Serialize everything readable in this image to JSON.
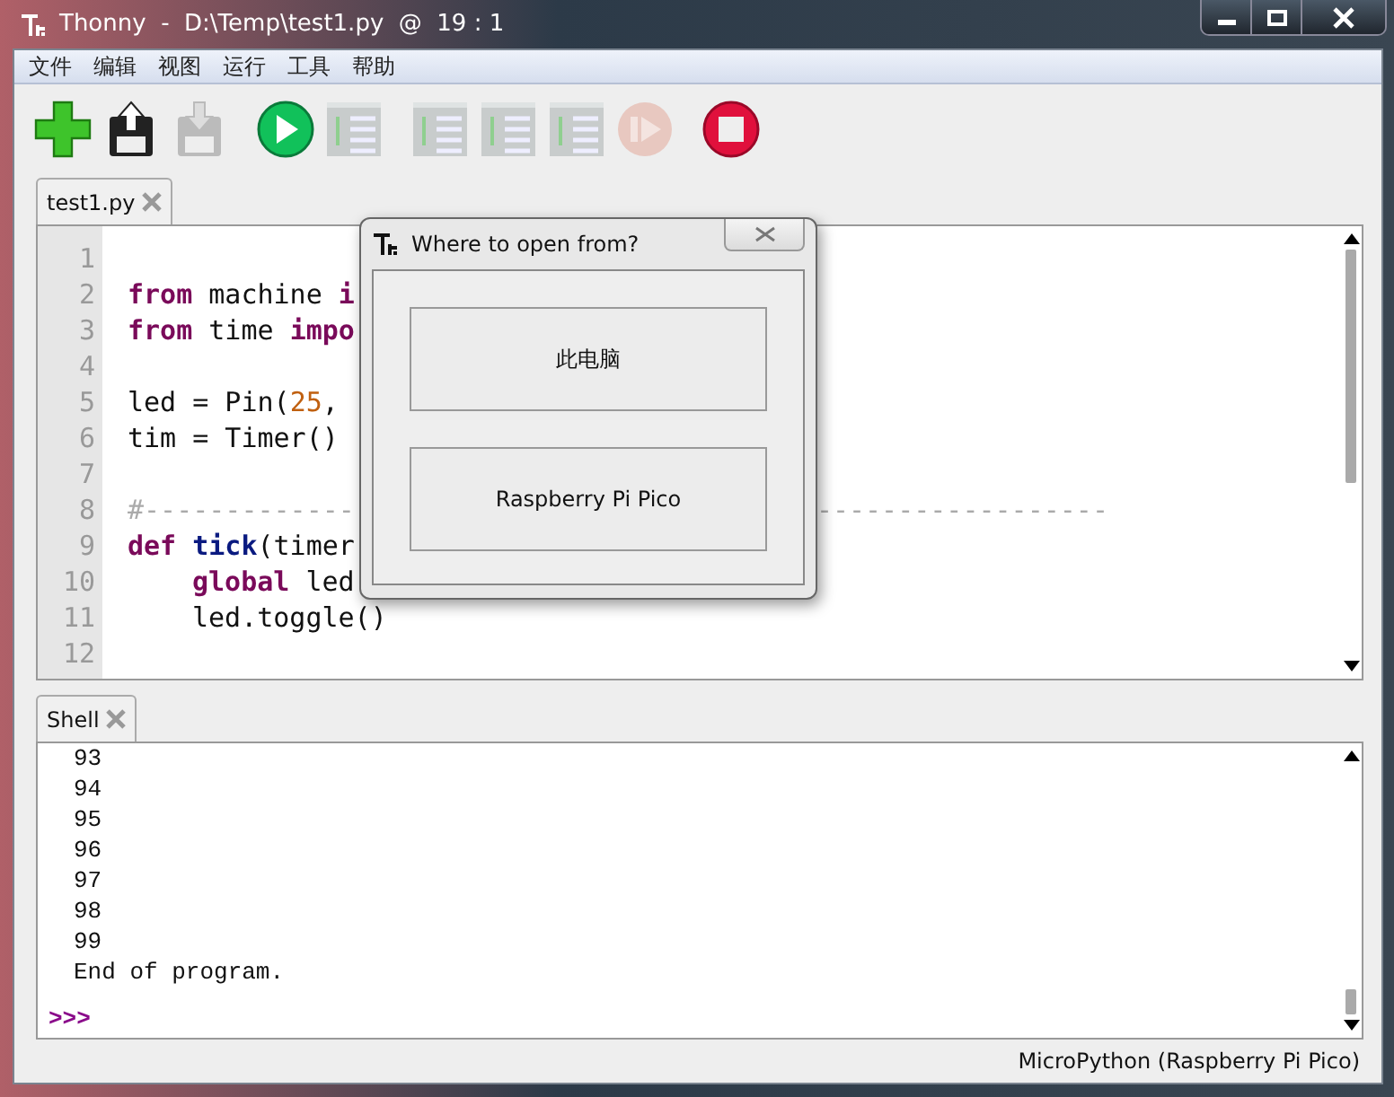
{
  "window": {
    "title": "Thonny  -  D:\\Temp\\test1.py  @  19 : 1"
  },
  "menu": [
    "文件",
    "编辑",
    "视图",
    "运行",
    "工具",
    "帮助"
  ],
  "toolbar": [
    {
      "kind": "new",
      "disabled": false
    },
    {
      "kind": "load",
      "disabled": false
    },
    {
      "kind": "save",
      "disabled": true
    },
    {
      "kind": "run",
      "disabled": false
    },
    {
      "kind": "debug",
      "disabled": true
    },
    {
      "kind": "step-over",
      "disabled": true
    },
    {
      "kind": "step-into",
      "disabled": true
    },
    {
      "kind": "step-out",
      "disabled": true
    },
    {
      "kind": "resume",
      "disabled": true
    },
    {
      "kind": "stop",
      "disabled": false
    }
  ],
  "editor_tabs": [
    {
      "label": "test1.py",
      "selected": true
    }
  ],
  "editor": {
    "lines": [
      {
        "number": "1"
      },
      {
        "number": "2",
        "tokens": [
          {
            "kind": "keyword",
            "text": "from"
          },
          {
            "kind": "plain",
            "text": " machine "
          },
          {
            "kind": "keyword",
            "text": "i"
          }
        ]
      },
      {
        "number": "3",
        "tokens": [
          {
            "kind": "keyword",
            "text": "from"
          },
          {
            "kind": "plain",
            "text": " time "
          },
          {
            "kind": "keyword",
            "text": "impo"
          }
        ]
      },
      {
        "number": "4"
      },
      {
        "number": "5",
        "tokens": [
          {
            "kind": "plain",
            "text": "led = Pin("
          },
          {
            "kind": "number",
            "text": "25"
          },
          {
            "kind": "plain",
            "text": ", "
          }
        ]
      },
      {
        "number": "6",
        "tokens": [
          {
            "kind": "plain",
            "text": "tim = Timer()"
          }
        ]
      },
      {
        "number": "7"
      },
      {
        "number": "8",
        "tokens": [
          {
            "kind": "comment",
            "text": "#-------------"
          },
          {
            "kind": "comment-tail",
            "text": "------------------"
          }
        ]
      },
      {
        "number": "9",
        "tokens": [
          {
            "kind": "keyword",
            "text": "def"
          },
          {
            "kind": "function",
            "text": " tick"
          },
          {
            "kind": "plain",
            "text": "(timer"
          }
        ]
      },
      {
        "number": "10",
        "indent": true,
        "tokens": [
          {
            "kind": "keyword",
            "text": "global"
          },
          {
            "kind": "plain",
            "text": " led"
          }
        ]
      },
      {
        "number": "11",
        "indent": true,
        "tokens": [
          {
            "kind": "plain",
            "text": "led.toggle()"
          }
        ]
      },
      {
        "number": "12"
      }
    ]
  },
  "shell_tabs": [
    {
      "label": "Shell",
      "selected": true
    }
  ],
  "shell": {
    "output": [
      "93",
      "94",
      "95",
      "96",
      "97",
      "98",
      "99",
      "End of program."
    ],
    "prompt": ">>>"
  },
  "status_bar": {
    "interpreter": "MicroPython (Raspberry Pi Pico)"
  },
  "dialog": {
    "title": "Where to open from?",
    "buttons": [
      "此电脑",
      "Raspberry Pi Pico"
    ]
  }
}
